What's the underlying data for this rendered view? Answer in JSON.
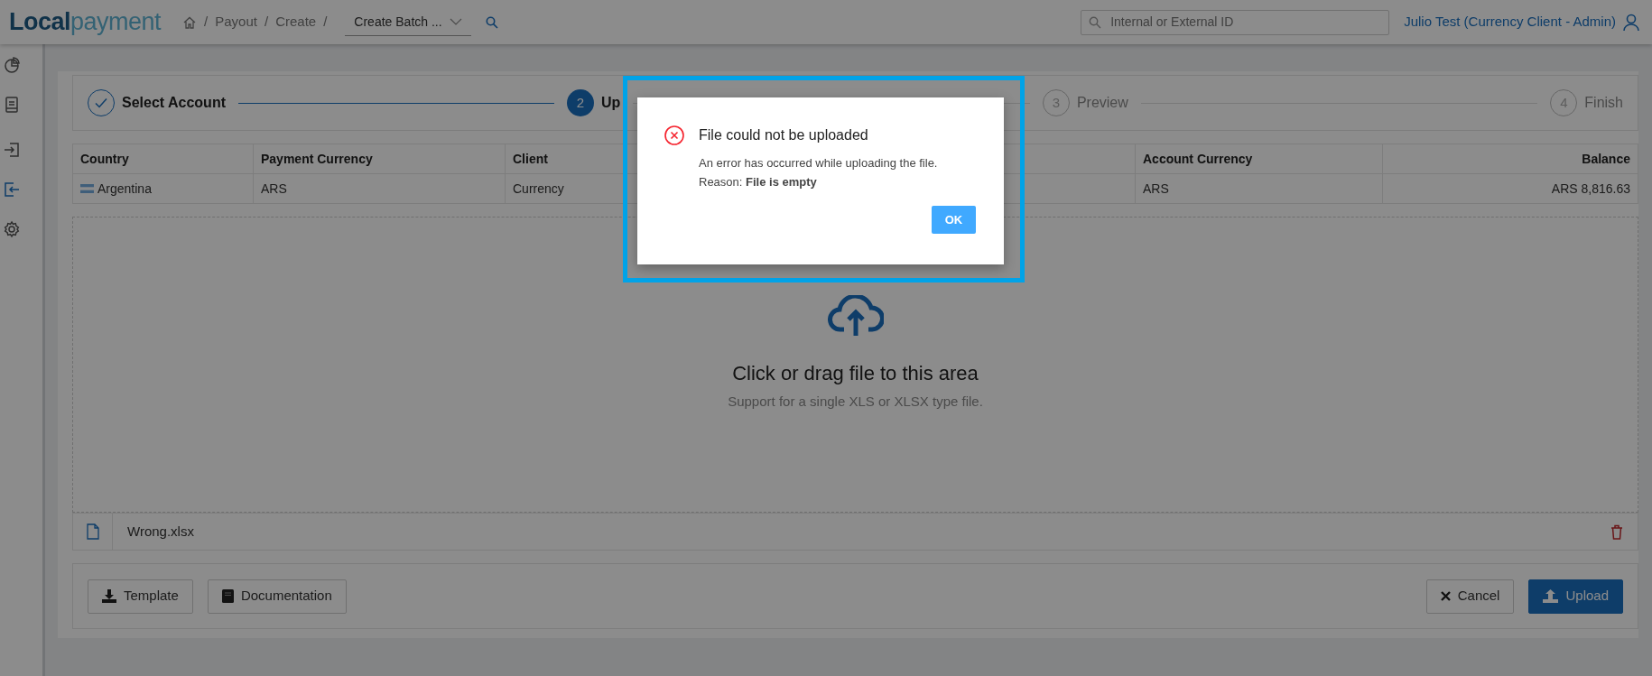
{
  "header": {
    "logo": {
      "part_1": "Local",
      "part_2": "payment"
    },
    "breadcrumb": [
      {
        "kind": "home"
      },
      {
        "kind": "separator",
        "text": "/"
      },
      {
        "kind": "link",
        "text": "Payout"
      },
      {
        "kind": "separator",
        "text": "/"
      },
      {
        "kind": "link",
        "text": "Create"
      },
      {
        "kind": "separator",
        "text": "/"
      }
    ],
    "batch_select": {
      "value": "Create Batch ..."
    },
    "search": {
      "placeholder": "Internal or External ID"
    },
    "user": {
      "name": "Julio Test (Currency Client - Admin)"
    }
  },
  "sidebar": {
    "items": [
      {
        "kind": "chart",
        "selected": false
      },
      {
        "kind": "report",
        "selected": false
      },
      {
        "kind": "payin",
        "selected": false
      },
      {
        "kind": "payout",
        "selected": true
      },
      {
        "kind": "settings",
        "selected": false
      }
    ]
  },
  "steps": [
    {
      "label": "Select Account",
      "done": true,
      "selected": false
    },
    {
      "number": "2",
      "label": "Up",
      "done": false,
      "selected": true
    },
    {
      "number": "3",
      "label": "Preview",
      "done": false,
      "selected": false
    },
    {
      "number": "4",
      "label": "Finish",
      "done": false,
      "selected": false
    }
  ],
  "table": {
    "columns": [
      {
        "label": "Country",
        "numeric": false
      },
      {
        "label": "Payment Currency",
        "numeric": false
      },
      {
        "label": "Client",
        "numeric": false
      },
      {
        "label": "Account Currency",
        "numeric": false
      },
      {
        "label": "Balance",
        "numeric": true
      }
    ],
    "rows": [
      {
        "cells": [
          "Argentina",
          "ARS",
          "Currency",
          "ARS",
          "ARS 8,816.63"
        ]
      }
    ]
  },
  "dropzone": {
    "title": "Click or drag file to this area",
    "hint": "Support for a single XLS or XLSX type file."
  },
  "file": {
    "name": "Wrong.xlsx"
  },
  "footer": {
    "left_buttons": [
      {
        "kind": "template",
        "label": "Template"
      },
      {
        "kind": "documentation",
        "label": "Documentation"
      }
    ],
    "cancel": {
      "label": "Cancel"
    },
    "upload": {
      "label": "Upload"
    }
  },
  "dialog": {
    "title": "File could not be uploaded",
    "message": "An error has occurred while uploading the file.",
    "reason": "Reason: **File is empty**",
    "ok": "OK",
    "highlighted": true
  }
}
